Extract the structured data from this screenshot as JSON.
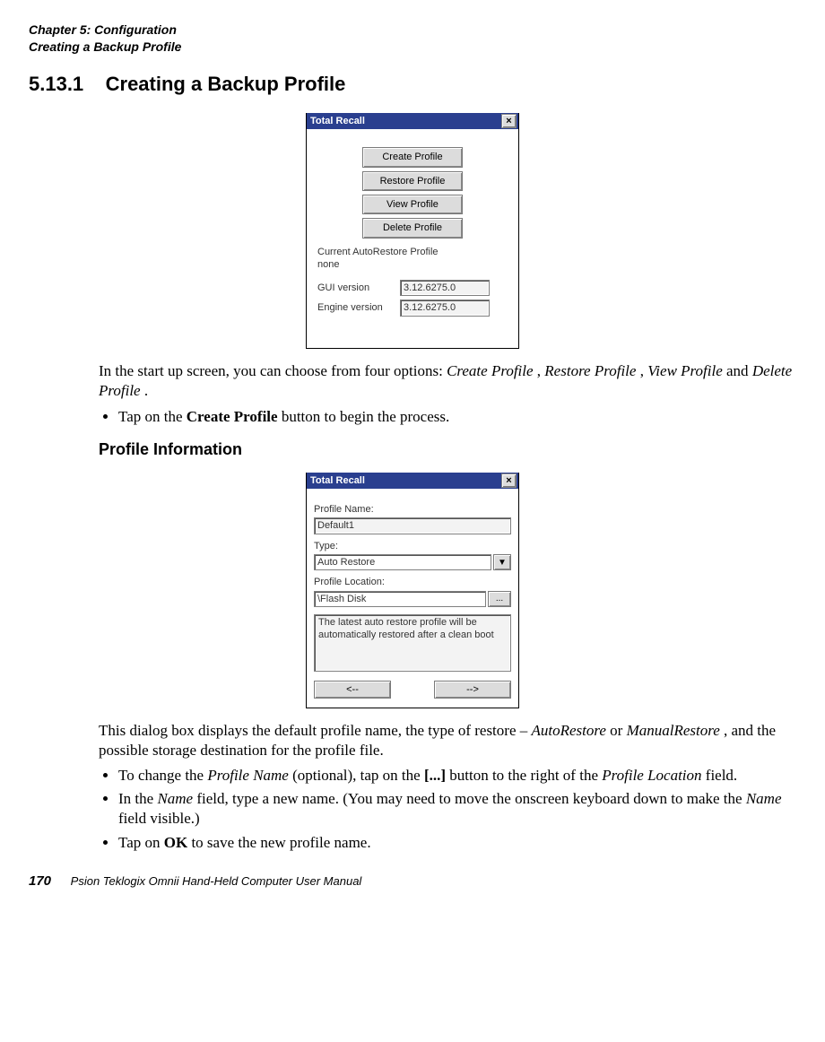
{
  "header": {
    "line1": "Chapter 5:  Configuration",
    "line2": "Creating a Backup Profile"
  },
  "section": {
    "number": "5.13.1",
    "title": "Creating a Backup Profile"
  },
  "dialog1": {
    "title": "Total Recall",
    "btn_create": "Create Profile",
    "btn_restore": "Restore Profile",
    "btn_view": "View Profile",
    "btn_delete": "Delete Profile",
    "cur_label": "Current AutoRestore Profile",
    "cur_value": "none",
    "gui_label": "GUI version",
    "gui_value": "3.12.6275.0",
    "eng_label": "Engine version",
    "eng_value": "3.12.6275.0"
  },
  "para_after_d1_parts": {
    "p1a": "In the start up screen, you can choose from four options: ",
    "p1b": "Create Profile",
    "p1c": ", ",
    "p1d": "Restore Profile",
    "p1e": ", ",
    "p1f": "View Profile",
    "p1g": " and ",
    "p1h": "Delete Profile",
    "p1i": "."
  },
  "li_createprofile": {
    "a": "Tap on the ",
    "b": "Create Profile",
    "c": " button to begin the process."
  },
  "subheading": "Profile Information",
  "dialog2": {
    "title": "Total Recall",
    "name_label": "Profile Name:",
    "name_value": "Default1",
    "type_label": "Type:",
    "type_value": "Auto Restore",
    "loc_label": "Profile Location:",
    "loc_value": "\\Flash Disk",
    "browse_label": "...",
    "desc": "The latest auto restore profile will be automatically restored after a clean boot",
    "prev": "<--",
    "next": "-->"
  },
  "para_after_d2_parts": {
    "a": "This dialog box displays the default profile name, the type of restore – ",
    "b": "AutoRestore",
    "c": " or ",
    "d": "ManualRestore",
    "e": ", and the possible storage destination for the profile file."
  },
  "bullets2": {
    "b1": {
      "a": "To change the ",
      "b": "Profile Name",
      "c": " (optional), tap on the ",
      "d": "[...]",
      "e": " button to the right of the ",
      "f": "Profile Location",
      "g": " field."
    },
    "b2": {
      "a": "In the ",
      "b": "Name",
      "c": " field, type a new name. (You may need to move the onscreen keyboard down to make the ",
      "d": "Name",
      "e": " field visible.)"
    },
    "b3": {
      "a": "Tap on ",
      "b": "OK",
      "c": " to save the new profile name."
    }
  },
  "footer": {
    "page": "170",
    "text": "Psion Teklogix Omnii Hand-Held Computer User Manual"
  }
}
